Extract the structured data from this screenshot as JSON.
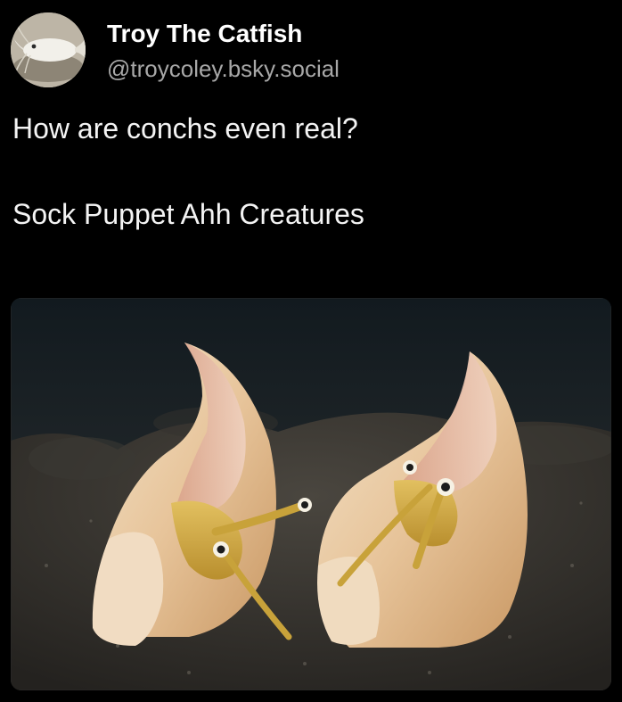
{
  "post": {
    "author": {
      "display_name": "Troy The Catfish",
      "handle": "@troycoley.bsky.social",
      "avatar_icon": "catfish-avatar"
    },
    "text_lines": [
      "How are conchs even real?",
      "Sock Puppet Ahh Creatures"
    ],
    "media": {
      "subject": "two conch snails emerging from dark sand"
    }
  },
  "colors": {
    "background": "#000000",
    "name": "#ffffff",
    "handle": "#a8a8a8",
    "text": "#f4f4f4"
  }
}
